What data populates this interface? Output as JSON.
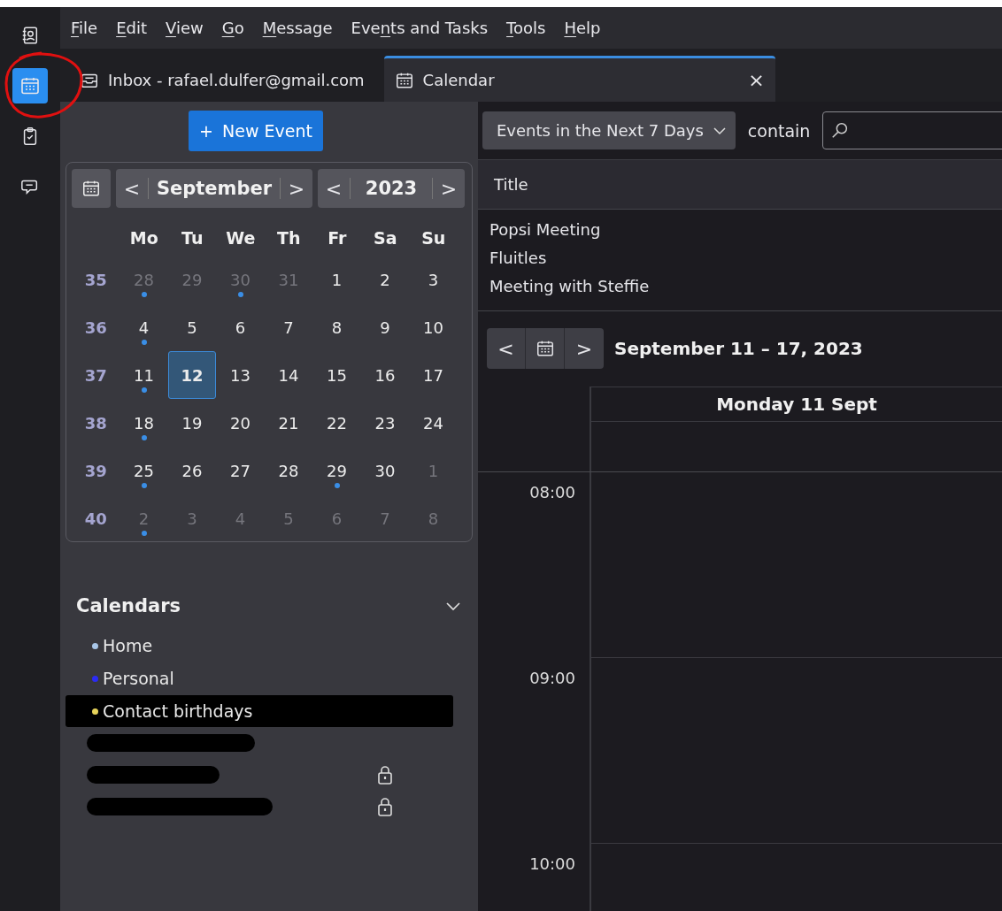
{
  "rail": [
    {
      "kind": "contacts",
      "selected": false
    },
    {
      "kind": "calendar",
      "selected": true
    },
    {
      "kind": "tasks",
      "selected": false
    },
    {
      "kind": "chat",
      "selected": false
    }
  ],
  "menu": [
    {
      "key": "F",
      "post": "ile"
    },
    {
      "key": "E",
      "post": "dit"
    },
    {
      "key": "V",
      "post": "iew"
    },
    {
      "key": "G",
      "post": "o"
    },
    {
      "key": "M",
      "post": "essage"
    },
    {
      "pre": "Eve",
      "key": "n",
      "post": "ts and Tasks"
    },
    {
      "key": "T",
      "post": "ools"
    },
    {
      "key": "H",
      "post": "elp"
    }
  ],
  "tabs": [
    {
      "kind": "inbox",
      "label": "Inbox - rafael.dulfer@gmail.com",
      "selected": false
    },
    {
      "kind": "calendar",
      "label": "Calendar",
      "selected": true,
      "close": "×"
    }
  ],
  "new_event": {
    "plus": "+",
    "label": "New Event"
  },
  "minimonth": {
    "month": "September",
    "year": "2023",
    "prev": "<",
    "next": ">",
    "weekdays": [
      "Mo",
      "Tu",
      "We",
      "Th",
      "Fr",
      "Sa",
      "Su"
    ],
    "weeks": [
      {
        "number": "35",
        "days": [
          {
            "label": "28",
            "other_month": true,
            "has_events": true,
            "selected": false
          },
          {
            "label": "29",
            "other_month": true,
            "has_events": false,
            "selected": false
          },
          {
            "label": "30",
            "other_month": true,
            "has_events": true,
            "selected": false
          },
          {
            "label": "31",
            "other_month": true,
            "has_events": false,
            "selected": false
          },
          {
            "label": "1",
            "other_month": false,
            "has_events": false,
            "selected": false
          },
          {
            "label": "2",
            "other_month": false,
            "has_events": false,
            "selected": false
          },
          {
            "label": "3",
            "other_month": false,
            "has_events": false,
            "selected": false
          }
        ]
      },
      {
        "number": "36",
        "days": [
          {
            "label": "4",
            "other_month": false,
            "has_events": true,
            "selected": false
          },
          {
            "label": "5",
            "other_month": false,
            "has_events": false,
            "selected": false
          },
          {
            "label": "6",
            "other_month": false,
            "has_events": false,
            "selected": false
          },
          {
            "label": "7",
            "other_month": false,
            "has_events": false,
            "selected": false
          },
          {
            "label": "8",
            "other_month": false,
            "has_events": false,
            "selected": false
          },
          {
            "label": "9",
            "other_month": false,
            "has_events": false,
            "selected": false
          },
          {
            "label": "10",
            "other_month": false,
            "has_events": false,
            "selected": false
          }
        ]
      },
      {
        "number": "37",
        "days": [
          {
            "label": "11",
            "other_month": false,
            "has_events": true,
            "selected": false
          },
          {
            "label": "12",
            "other_month": false,
            "has_events": false,
            "selected": true
          },
          {
            "label": "13",
            "other_month": false,
            "has_events": false,
            "selected": false
          },
          {
            "label": "14",
            "other_month": false,
            "has_events": false,
            "selected": false
          },
          {
            "label": "15",
            "other_month": false,
            "has_events": false,
            "selected": false
          },
          {
            "label": "16",
            "other_month": false,
            "has_events": false,
            "selected": false
          },
          {
            "label": "17",
            "other_month": false,
            "has_events": false,
            "selected": false
          }
        ]
      },
      {
        "number": "38",
        "days": [
          {
            "label": "18",
            "other_month": false,
            "has_events": true,
            "selected": false
          },
          {
            "label": "19",
            "other_month": false,
            "has_events": false,
            "selected": false
          },
          {
            "label": "20",
            "other_month": false,
            "has_events": false,
            "selected": false
          },
          {
            "label": "21",
            "other_month": false,
            "has_events": false,
            "selected": false
          },
          {
            "label": "22",
            "other_month": false,
            "has_events": false,
            "selected": false
          },
          {
            "label": "23",
            "other_month": false,
            "has_events": false,
            "selected": false
          },
          {
            "label": "24",
            "other_month": false,
            "has_events": false,
            "selected": false
          }
        ]
      },
      {
        "number": "39",
        "days": [
          {
            "label": "25",
            "other_month": false,
            "has_events": true,
            "selected": false
          },
          {
            "label": "26",
            "other_month": false,
            "has_events": false,
            "selected": false
          },
          {
            "label": "27",
            "other_month": false,
            "has_events": false,
            "selected": false
          },
          {
            "label": "28",
            "other_month": false,
            "has_events": false,
            "selected": false
          },
          {
            "label": "29",
            "other_month": false,
            "has_events": true,
            "selected": false
          },
          {
            "label": "30",
            "other_month": false,
            "has_events": false,
            "selected": false
          },
          {
            "label": "1",
            "other_month": true,
            "has_events": false,
            "selected": false
          }
        ]
      },
      {
        "number": "40",
        "days": [
          {
            "label": "2",
            "other_month": true,
            "has_events": true,
            "selected": false
          },
          {
            "label": "3",
            "other_month": true,
            "has_events": false,
            "selected": false
          },
          {
            "label": "4",
            "other_month": true,
            "has_events": false,
            "selected": false
          },
          {
            "label": "5",
            "other_month": true,
            "has_events": false,
            "selected": false
          },
          {
            "label": "6",
            "other_month": true,
            "has_events": false,
            "selected": false
          },
          {
            "label": "7",
            "other_month": true,
            "has_events": false,
            "selected": false
          },
          {
            "label": "8",
            "other_month": true,
            "has_events": false,
            "selected": false
          }
        ]
      }
    ]
  },
  "calendars": {
    "title": "Calendars",
    "expanded": true,
    "items": [
      {
        "name": "Home",
        "color": "#a9c6e8",
        "selected": false
      },
      {
        "name": "Personal",
        "color": "#2b2bf5",
        "selected": false
      },
      {
        "name": "Contact birthdays",
        "color": "#e6d25a",
        "selected": true
      }
    ],
    "redacted_rows": [
      {
        "locked": false
      },
      {
        "locked": true
      },
      {
        "locked": true
      }
    ]
  },
  "filter": {
    "range": "Events in the Next 7 Days",
    "contain": "contain"
  },
  "events_table": {
    "columns": [
      "Title"
    ],
    "rows": [
      "Popsi Meeting",
      "Fluitles",
      "Meeting with Steffie"
    ]
  },
  "week_view": {
    "range": "September 11 – 17, 2023",
    "day": "Monday 11 Sept",
    "hours": [
      "08:00",
      "09:00",
      "10:00"
    ]
  }
}
